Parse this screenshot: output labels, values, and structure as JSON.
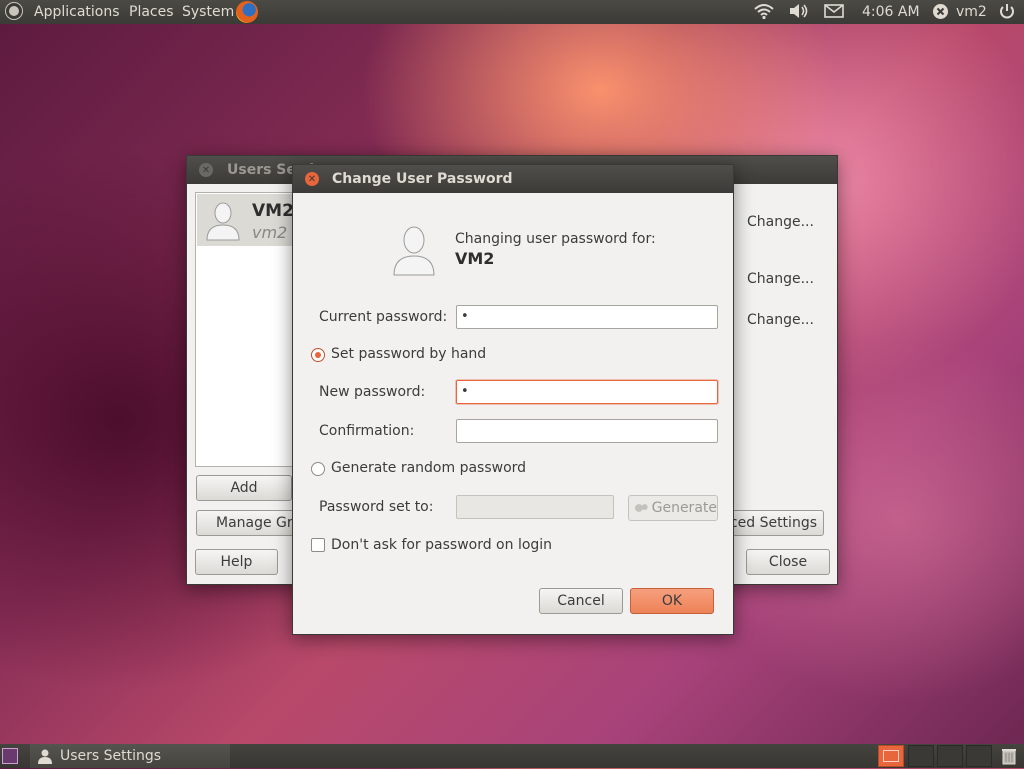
{
  "top_panel": {
    "menus": [
      "Applications",
      "Places",
      "System"
    ],
    "clock": "4:06 AM",
    "user": "vm2",
    "icons": [
      "ubuntu-logo-icon",
      "firefox-icon",
      "wifi-icon",
      "volume-icon",
      "mail-icon",
      "user-status-icon",
      "power-icon"
    ]
  },
  "bottom_panel": {
    "task_label": "Users Settings",
    "icons": [
      "show-desktop-icon",
      "users-settings-icon",
      "trash-icon"
    ]
  },
  "users_window": {
    "title": "Users Settings",
    "user_name": "VM2",
    "user_login": "vm2",
    "change_1": "Change...",
    "change_2": "Change...",
    "change_3": "Change...",
    "add_label": "Add",
    "manage_label": "Manage Groups",
    "advanced_label": "Advanced Settings",
    "help_label": "Help",
    "close_label": "Close"
  },
  "dialog": {
    "title": "Change User Password",
    "header_line1": "Changing user password for:",
    "header_user": "VM2",
    "current_password_label": "Current password:",
    "current_password_value": "•",
    "set_by_hand_label": "Set password by hand",
    "new_password_label": "New password:",
    "new_password_value": "•",
    "confirmation_label": "Confirmation:",
    "confirmation_value": "",
    "generate_random_label": "Generate random password",
    "password_set_to_label": "Password set to:",
    "password_set_to_value": "",
    "generate_label": "Generate",
    "dont_ask_label": "Don't ask for password on login",
    "cancel_label": "Cancel",
    "ok_label": "OK",
    "accent_color": "#e9653b"
  }
}
